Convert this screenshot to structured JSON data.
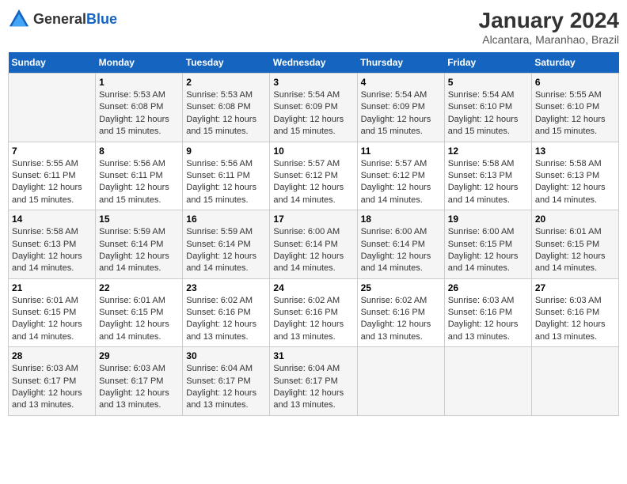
{
  "logo": {
    "text_general": "General",
    "text_blue": "Blue"
  },
  "header": {
    "title": "January 2024",
    "subtitle": "Alcantara, Maranhao, Brazil"
  },
  "days_of_week": [
    "Sunday",
    "Monday",
    "Tuesday",
    "Wednesday",
    "Thursday",
    "Friday",
    "Saturday"
  ],
  "weeks": [
    [
      {
        "day": "",
        "info": ""
      },
      {
        "day": "1",
        "info": "Sunrise: 5:53 AM\nSunset: 6:08 PM\nDaylight: 12 hours\nand 15 minutes."
      },
      {
        "day": "2",
        "info": "Sunrise: 5:53 AM\nSunset: 6:08 PM\nDaylight: 12 hours\nand 15 minutes."
      },
      {
        "day": "3",
        "info": "Sunrise: 5:54 AM\nSunset: 6:09 PM\nDaylight: 12 hours\nand 15 minutes."
      },
      {
        "day": "4",
        "info": "Sunrise: 5:54 AM\nSunset: 6:09 PM\nDaylight: 12 hours\nand 15 minutes."
      },
      {
        "day": "5",
        "info": "Sunrise: 5:54 AM\nSunset: 6:10 PM\nDaylight: 12 hours\nand 15 minutes."
      },
      {
        "day": "6",
        "info": "Sunrise: 5:55 AM\nSunset: 6:10 PM\nDaylight: 12 hours\nand 15 minutes."
      }
    ],
    [
      {
        "day": "7",
        "info": "Sunrise: 5:55 AM\nSunset: 6:11 PM\nDaylight: 12 hours\nand 15 minutes."
      },
      {
        "day": "8",
        "info": "Sunrise: 5:56 AM\nSunset: 6:11 PM\nDaylight: 12 hours\nand 15 minutes."
      },
      {
        "day": "9",
        "info": "Sunrise: 5:56 AM\nSunset: 6:11 PM\nDaylight: 12 hours\nand 15 minutes."
      },
      {
        "day": "10",
        "info": "Sunrise: 5:57 AM\nSunset: 6:12 PM\nDaylight: 12 hours\nand 14 minutes."
      },
      {
        "day": "11",
        "info": "Sunrise: 5:57 AM\nSunset: 6:12 PM\nDaylight: 12 hours\nand 14 minutes."
      },
      {
        "day": "12",
        "info": "Sunrise: 5:58 AM\nSunset: 6:13 PM\nDaylight: 12 hours\nand 14 minutes."
      },
      {
        "day": "13",
        "info": "Sunrise: 5:58 AM\nSunset: 6:13 PM\nDaylight: 12 hours\nand 14 minutes."
      }
    ],
    [
      {
        "day": "14",
        "info": "Sunrise: 5:58 AM\nSunset: 6:13 PM\nDaylight: 12 hours\nand 14 minutes."
      },
      {
        "day": "15",
        "info": "Sunrise: 5:59 AM\nSunset: 6:14 PM\nDaylight: 12 hours\nand 14 minutes."
      },
      {
        "day": "16",
        "info": "Sunrise: 5:59 AM\nSunset: 6:14 PM\nDaylight: 12 hours\nand 14 minutes."
      },
      {
        "day": "17",
        "info": "Sunrise: 6:00 AM\nSunset: 6:14 PM\nDaylight: 12 hours\nand 14 minutes."
      },
      {
        "day": "18",
        "info": "Sunrise: 6:00 AM\nSunset: 6:14 PM\nDaylight: 12 hours\nand 14 minutes."
      },
      {
        "day": "19",
        "info": "Sunrise: 6:00 AM\nSunset: 6:15 PM\nDaylight: 12 hours\nand 14 minutes."
      },
      {
        "day": "20",
        "info": "Sunrise: 6:01 AM\nSunset: 6:15 PM\nDaylight: 12 hours\nand 14 minutes."
      }
    ],
    [
      {
        "day": "21",
        "info": "Sunrise: 6:01 AM\nSunset: 6:15 PM\nDaylight: 12 hours\nand 14 minutes."
      },
      {
        "day": "22",
        "info": "Sunrise: 6:01 AM\nSunset: 6:15 PM\nDaylight: 12 hours\nand 14 minutes."
      },
      {
        "day": "23",
        "info": "Sunrise: 6:02 AM\nSunset: 6:16 PM\nDaylight: 12 hours\nand 13 minutes."
      },
      {
        "day": "24",
        "info": "Sunrise: 6:02 AM\nSunset: 6:16 PM\nDaylight: 12 hours\nand 13 minutes."
      },
      {
        "day": "25",
        "info": "Sunrise: 6:02 AM\nSunset: 6:16 PM\nDaylight: 12 hours\nand 13 minutes."
      },
      {
        "day": "26",
        "info": "Sunrise: 6:03 AM\nSunset: 6:16 PM\nDaylight: 12 hours\nand 13 minutes."
      },
      {
        "day": "27",
        "info": "Sunrise: 6:03 AM\nSunset: 6:16 PM\nDaylight: 12 hours\nand 13 minutes."
      }
    ],
    [
      {
        "day": "28",
        "info": "Sunrise: 6:03 AM\nSunset: 6:17 PM\nDaylight: 12 hours\nand 13 minutes."
      },
      {
        "day": "29",
        "info": "Sunrise: 6:03 AM\nSunset: 6:17 PM\nDaylight: 12 hours\nand 13 minutes."
      },
      {
        "day": "30",
        "info": "Sunrise: 6:04 AM\nSunset: 6:17 PM\nDaylight: 12 hours\nand 13 minutes."
      },
      {
        "day": "31",
        "info": "Sunrise: 6:04 AM\nSunset: 6:17 PM\nDaylight: 12 hours\nand 13 minutes."
      },
      {
        "day": "",
        "info": ""
      },
      {
        "day": "",
        "info": ""
      },
      {
        "day": "",
        "info": ""
      }
    ]
  ]
}
